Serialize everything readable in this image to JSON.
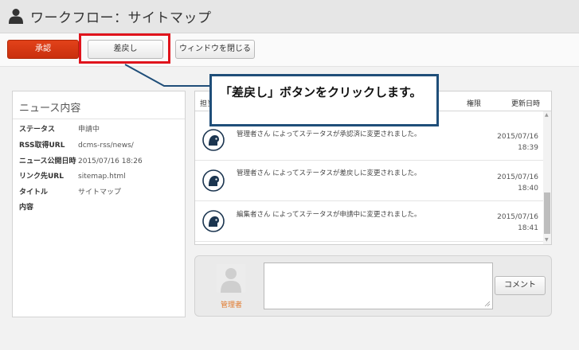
{
  "window": {
    "title": "ワークフロー：サイトマップ"
  },
  "toolbar": {
    "approve_label": "承認",
    "return_label": "差戻し",
    "close_label": "ウィンドウを閉じる"
  },
  "callout": {
    "text": "「差戻し」ボタンをクリックします。"
  },
  "news": {
    "title": "ニュース内容",
    "fields": [
      {
        "key": "ステータス",
        "value": "申請中"
      },
      {
        "key": "RSS取得URL",
        "value": "dcms-rss/news/"
      },
      {
        "key": "ニュース公開日時",
        "value": "2015/07/16 18:26"
      },
      {
        "key": "リンク先URL",
        "value": "sitemap.html"
      },
      {
        "key": "タイトル",
        "value": "サイトマップ"
      },
      {
        "key": "内容",
        "value": ""
      }
    ]
  },
  "history": {
    "header_user": "担当",
    "header_permission": "権限",
    "header_updated": "更新日時",
    "rows": [
      {
        "message": "管理者さん によってステータスが承認済に変更されました。",
        "date": "2015/07/16",
        "time": "18:39"
      },
      {
        "message": "管理者さん によってステータスが差戻しに変更されました。",
        "date": "2015/07/16",
        "time": "18:40"
      },
      {
        "message": "編集者さん によってステータスが申請中に変更されました。",
        "date": "2015/07/16",
        "time": "18:41"
      }
    ]
  },
  "comment": {
    "user_label": "管理者",
    "button_label": "コメント"
  },
  "colors": {
    "approve": "#d6390f",
    "highlight": "#e0141c",
    "callout_border": "#1f4e79",
    "user_label": "#e0782b"
  }
}
